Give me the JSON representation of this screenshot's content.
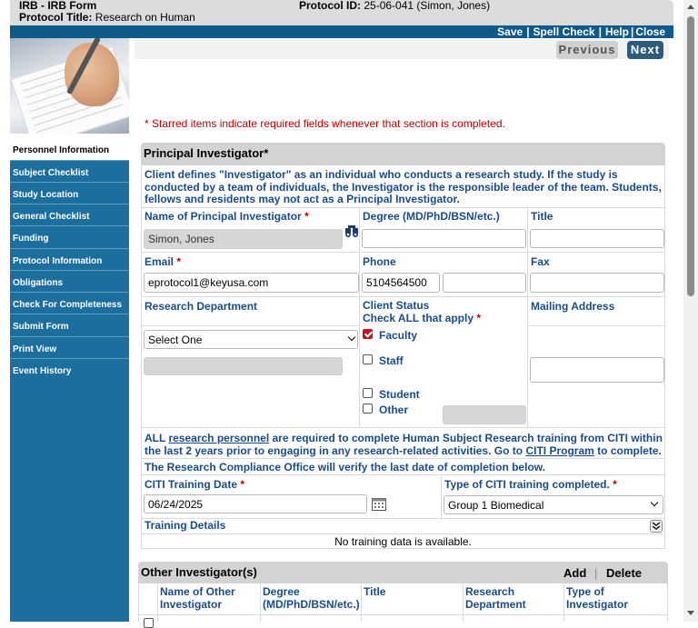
{
  "header": {
    "app_title": "IRB - IRB Form",
    "protocol_title_label": "Protocol Title:",
    "protocol_title_value": "Research on Human",
    "protocol_id_label": "Protocol ID:",
    "protocol_id_value": "25-06-041 (Simon, Jones)"
  },
  "toolbar": {
    "save": "Save",
    "spell_check": "Spell Check",
    "help": "Help",
    "close": "Close",
    "sep": "|"
  },
  "sidebar": {
    "items": [
      {
        "label": "Personnel Information",
        "active": true
      },
      {
        "label": "Subject Checklist"
      },
      {
        "label": "Study Location"
      },
      {
        "label": "General Checklist"
      },
      {
        "label": "Funding"
      },
      {
        "label": "Protocol Information"
      },
      {
        "label": "Obligations"
      },
      {
        "label": "Check For Completeness"
      },
      {
        "label": "Submit Form"
      },
      {
        "label": "Print View"
      },
      {
        "label": "Event History"
      }
    ]
  },
  "nav_buttons": {
    "previous": "Previous",
    "next": "Next"
  },
  "required_note": "* Starred items indicate required fields whenever that section is completed.",
  "pi_section": {
    "title": "Principal Investigator*",
    "description": "Client defines \"Investigator\" as an individual who conducts a research study. If the study is conducted by a team of individuals, the Investigator is the responsible leader of the team. Students, fellows and residents may not act as a Principal Investigator.",
    "name_label": "Name of Principal Investigator",
    "name_value": "Simon, Jones",
    "degree_label": "Degree (MD/PhD/BSN/etc.)",
    "degree_value": "",
    "title_label": "Title",
    "title_value": "",
    "email_label": "Email",
    "email_value": "eprotocol1@keyusa.com",
    "phone_label": "Phone",
    "phone_value": "5104564500",
    "phone_ext_value": "",
    "fax_label": "Fax",
    "fax_value": "",
    "dept_label": "Research Department",
    "dept_selected": "Select One",
    "client_status_label": "Client Status",
    "check_all_label": "Check ALL that apply",
    "status_options": [
      {
        "label": "Faculty",
        "checked": true
      },
      {
        "label": "Staff",
        "checked": false
      },
      {
        "label": "Student",
        "checked": false
      },
      {
        "label": "Other",
        "checked": false
      }
    ],
    "mailing_label": "Mailing Address",
    "mailing_value": "",
    "required_star": "*"
  },
  "citi": {
    "text_1": "ALL ",
    "link_personnel": "research personnel",
    "text_2": " are required to complete Human Subject Research training from CITI within the last 2 years prior to engaging in any research-related activities. Go to ",
    "link_program": "CITI Program",
    "text_3": " to complete.",
    "verify_note": "The Research Compliance Office will verify the last date of completion below.",
    "date_label": "CITI Training Date",
    "date_value": "06/24/2025",
    "type_label": "Type of CITI training completed.",
    "type_selected": "Group 1 Biomedical",
    "details_label": "Training Details",
    "no_data": "No training data is available."
  },
  "other_section": {
    "title": "Other Investigator(s)",
    "add": "Add",
    "delete": "Delete",
    "sep": "|",
    "columns": [
      "Name of Other Investigator",
      "Degree (MD/PhD/BSN/etc.)",
      "Title",
      "Research Department",
      "Type of Investigator"
    ]
  },
  "colors": {
    "brand_blue": "#1c6e9e",
    "toolbar": "#0e5a8a",
    "label_blue": "#1a4c8a",
    "required_red": "#c00000"
  }
}
